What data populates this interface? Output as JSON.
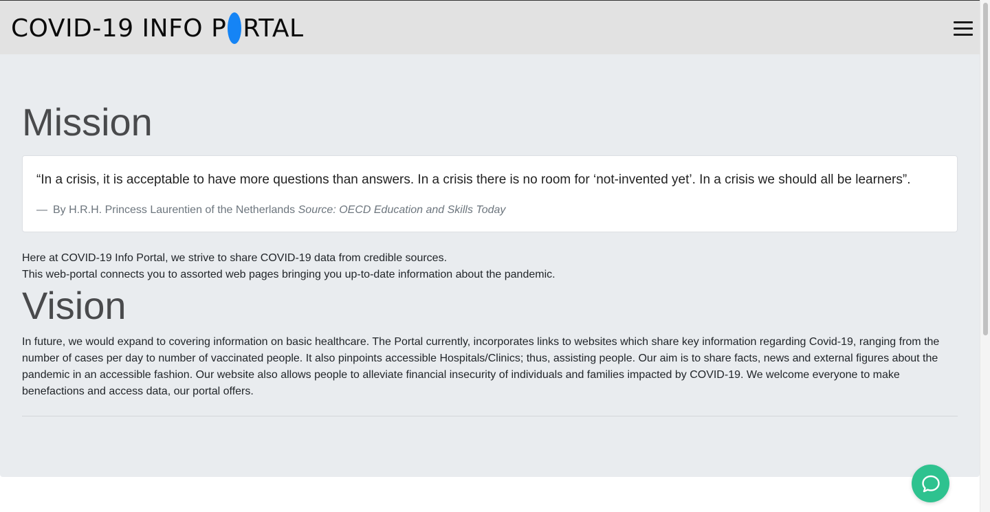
{
  "header": {
    "brand_before_o": "COVID-19 INFO P",
    "brand_after_o": "RTAL",
    "brand_accent_color": "#1584f5",
    "menu_icon": "hamburger-icon"
  },
  "mission": {
    "heading": "Mission",
    "quote": "“In a crisis, it is acceptable to have more questions than answers. In a crisis there is no room for ‘not-invented yet’. In a crisis we should all be learners”.",
    "quote_dash": "—",
    "attribution": "By H.R.H. Princess Laurentien of the Netherlands",
    "source": "Source: OECD Education and Skills Today",
    "line1": "Here at COVID-19 Info Portal, we strive to share COVID-19 data from credible sources.",
    "line2": "This web-portal connects you to assorted web pages bringing you up-to-date information about the pandemic."
  },
  "vision": {
    "heading": "Vision",
    "text": "In future, we would expand to covering information on basic healthcare. The Portal currently, incorporates links to websites which share key information regarding Covid-19, ranging from the number of cases per day to number of vaccinated people. It also pinpoints accessible Hospitals/Clinics; thus, assisting people. Our aim is to share facts, news and external figures about the pandemic in an accessible fashion. Our website also allows people to alleviate financial insecurity of individuals and families impacted by COVID-19. We welcome everyone to make benefactions and access data, our portal offers."
  },
  "chat": {
    "icon": "chat-bubble-icon",
    "color": "#2ec28f"
  }
}
